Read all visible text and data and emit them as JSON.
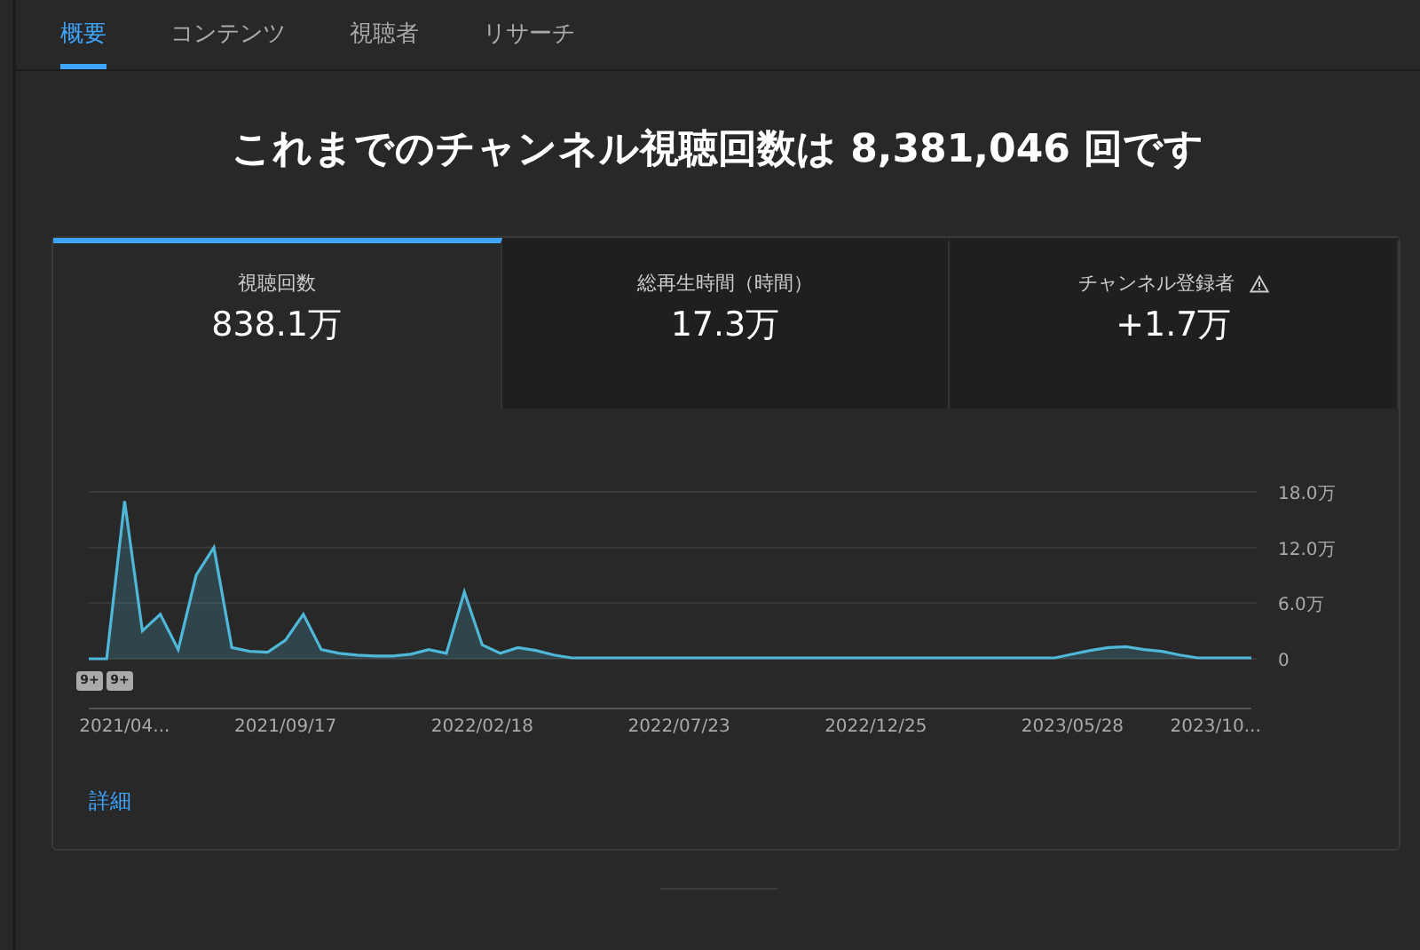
{
  "tabs": [
    {
      "label": "概要",
      "selected": true
    },
    {
      "label": "コンテンツ",
      "selected": false
    },
    {
      "label": "視聴者",
      "selected": false
    },
    {
      "label": "リサーチ",
      "selected": false
    }
  ],
  "headline": "これまでのチャンネル視聴回数は **8,381,046** 回です",
  "metrics": [
    {
      "label": "視聴回数",
      "value": "838.1万",
      "selected": true,
      "warning": false
    },
    {
      "label": "総再生時間（時間）",
      "value": "17.3万",
      "selected": false,
      "warning": false
    },
    {
      "label": "チャンネル登録者",
      "value": "+1.7万",
      "selected": false,
      "warning": true
    }
  ],
  "chart": {
    "chart_data": {
      "type": "area",
      "categories": [
        null,
        null,
        "2021/04...",
        null,
        null,
        null,
        null,
        null,
        null,
        null,
        null,
        "2021/09/17",
        null,
        null,
        null,
        null,
        null,
        null,
        null,
        null,
        null,
        null,
        "2022/02/18",
        null,
        null,
        null,
        null,
        null,
        null,
        null,
        null,
        null,
        null,
        "2022/07/23",
        null,
        null,
        null,
        null,
        null,
        null,
        null,
        null,
        null,
        null,
        "2022/12/25",
        null,
        null,
        null,
        null,
        null,
        null,
        null,
        null,
        null,
        null,
        "2023/05/28",
        null,
        null,
        null,
        null,
        null,
        null,
        null,
        "2023/10...",
        null,
        null
      ],
      "series": [
        {
          "color": "#4fb8d8",
          "values": [
            0,
            0,
            17,
            3,
            4.8,
            1,
            9,
            12,
            1.2,
            0.8,
            0.7,
            2,
            4.8,
            1,
            0.6,
            0.4,
            0.3,
            0.3,
            0.5,
            1,
            0.6,
            7.2,
            1.5,
            0.6,
            1.2,
            0.9,
            0.4,
            0.1,
            0.1,
            0.1,
            0.1,
            0.1,
            0.1,
            0.1,
            0.1,
            0.1,
            0.1,
            0.1,
            0.1,
            0.1,
            0.1,
            0.1,
            0.1,
            0.1,
            0.1,
            0.1,
            0.1,
            0.1,
            0.1,
            0.1,
            0.1,
            0.1,
            0.1,
            0.1,
            0.1,
            0.5,
            0.9,
            1.2,
            1.3,
            1.0,
            0.8,
            0.4,
            0.1,
            0.1,
            0.1,
            0.1
          ]
        }
      ],
      "ylim": [
        0,
        18
      ],
      "yticks": [
        {
          "value": 0,
          "label": "0"
        },
        {
          "value": 6,
          "label": "6.0万"
        },
        {
          "value": 12,
          "label": "12.0万"
        },
        {
          "value": 18,
          "label": "18.0万"
        }
      ]
    },
    "badges": [
      "9+",
      "9+"
    ]
  },
  "details_link": "詳細"
}
